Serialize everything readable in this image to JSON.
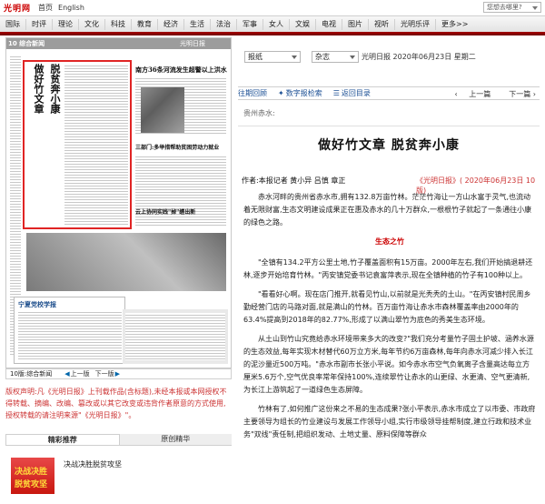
{
  "top": {
    "logo": "光明网",
    "links": [
      "首页",
      "English"
    ],
    "find_label": "您想去哪里?"
  },
  "nav": [
    "国际",
    "时评",
    "理论",
    "文化",
    "科技",
    "教育",
    "经济",
    "生活",
    "法治",
    "军事",
    "女人",
    "文娱",
    "电视",
    "图片",
    "视听",
    "光明乐评",
    "更多>>"
  ],
  "paper": {
    "page_label": "10 综合新闻",
    "logo": "光明日报",
    "headline_col1": "做好竹文章",
    "headline_col2": "脱贫奔小康",
    "headlines": [
      "南方36条河流发生超警以上洪水",
      "三部门:多举措帮助贫困劳动力就业",
      "云上协同实践\"掉\"缠出新"
    ],
    "box_title": "宁夏党校学报"
  },
  "page_nav": {
    "current": "10版:综合新闻",
    "prev": "上一版",
    "next": "下一版"
  },
  "copyright": "版权声明:凡《光明日报》上刊载作品(含标题),未经本报或本网授权不得转载、摘编、改编、篡改或以其它改变或违背作者原意的方式使用,授权转载的请注明来源\"《光明日报》\"。",
  "tabs": [
    "精彩推荐",
    "原创精华"
  ],
  "recommend": {
    "banner_line1": "决战决胜",
    "banner_line2": "脱贫攻坚",
    "text": "决战决胜脱贫攻坚"
  },
  "selectors": {
    "paper_type": "报纸",
    "magazine": "杂志"
  },
  "edition_date": "光明日报  2020年06月23日 星期二",
  "toolbar": {
    "date_search": "往期回顾",
    "digital": "数字报检索",
    "back": "返回目录",
    "prev_page": "上一篇",
    "next_page": "下一篇"
  },
  "section_label": "贵州赤水:",
  "article": {
    "title": "做好竹文章 脱贫奔小康",
    "byline": "作者:本报记者 黄小异 吕慎 章正",
    "source": "《光明日报》( 2020年06月23日 10版)",
    "p1": "赤水河畔的贵州省赤水市,拥有132.8万亩竹林。茫茫竹海让一方山水富于灵气,也流动着无限财富,生态文明建设成果正在惠及赤水的几十万群众,一根根竹子就起了一条通往小康的绿色之路。",
    "subtitle": "生态之竹",
    "p2": "\"全镇有134.2平方公里土地,竹子覆盖面积有15万亩。2000年左右,我们开始搞退耕还林,逐步开始培育竹林。\"丙安镇党委书记袁富萍表示,现在全镇种植的竹子有100种以上。",
    "p3": "\"看看好心啊。现在店门推开,就看见竹山,以前就是光秃秃的土山。\"在丙安镇村民周乡勤经营门店的马路对面,就是满山的竹林。百万亩竹海让赤水市森林覆盖率由2000年的63.4%提高到2018年的82.77%,形成了以满山翠竹为底色的秀美生态环境。",
    "p4": "从土山到竹山究竟给赤水环境带来多大的改变?\"我们充分考量竹子固土护坡、涵养水源的生态效益,每年实现木材替代60万立方米,每年节约6万亩森林,每年向赤水河减少排入长江的泥沙量近500万吨。\"赤水市副市长张小平说。如今赤水市空气负氧离子含量高达每立方厘米5.6万个,空气优良率常年保持100%,连续翠竹让赤水的山更绿、水更清、空气更清新,为长江上游筑起了一道绿色生态屏障。",
    "p5": "竹林有了,如何推广这份来之不易的生态成果?张小平表示,赤水市成立了以市委、市政府主要领导为组长的竹业建设与发展工作领导小组,实行市级领导挂帮制度,建立行政和技术业务\"双线\"责任制,把组织发动、土地丈量、原料保障等群众"
  }
}
